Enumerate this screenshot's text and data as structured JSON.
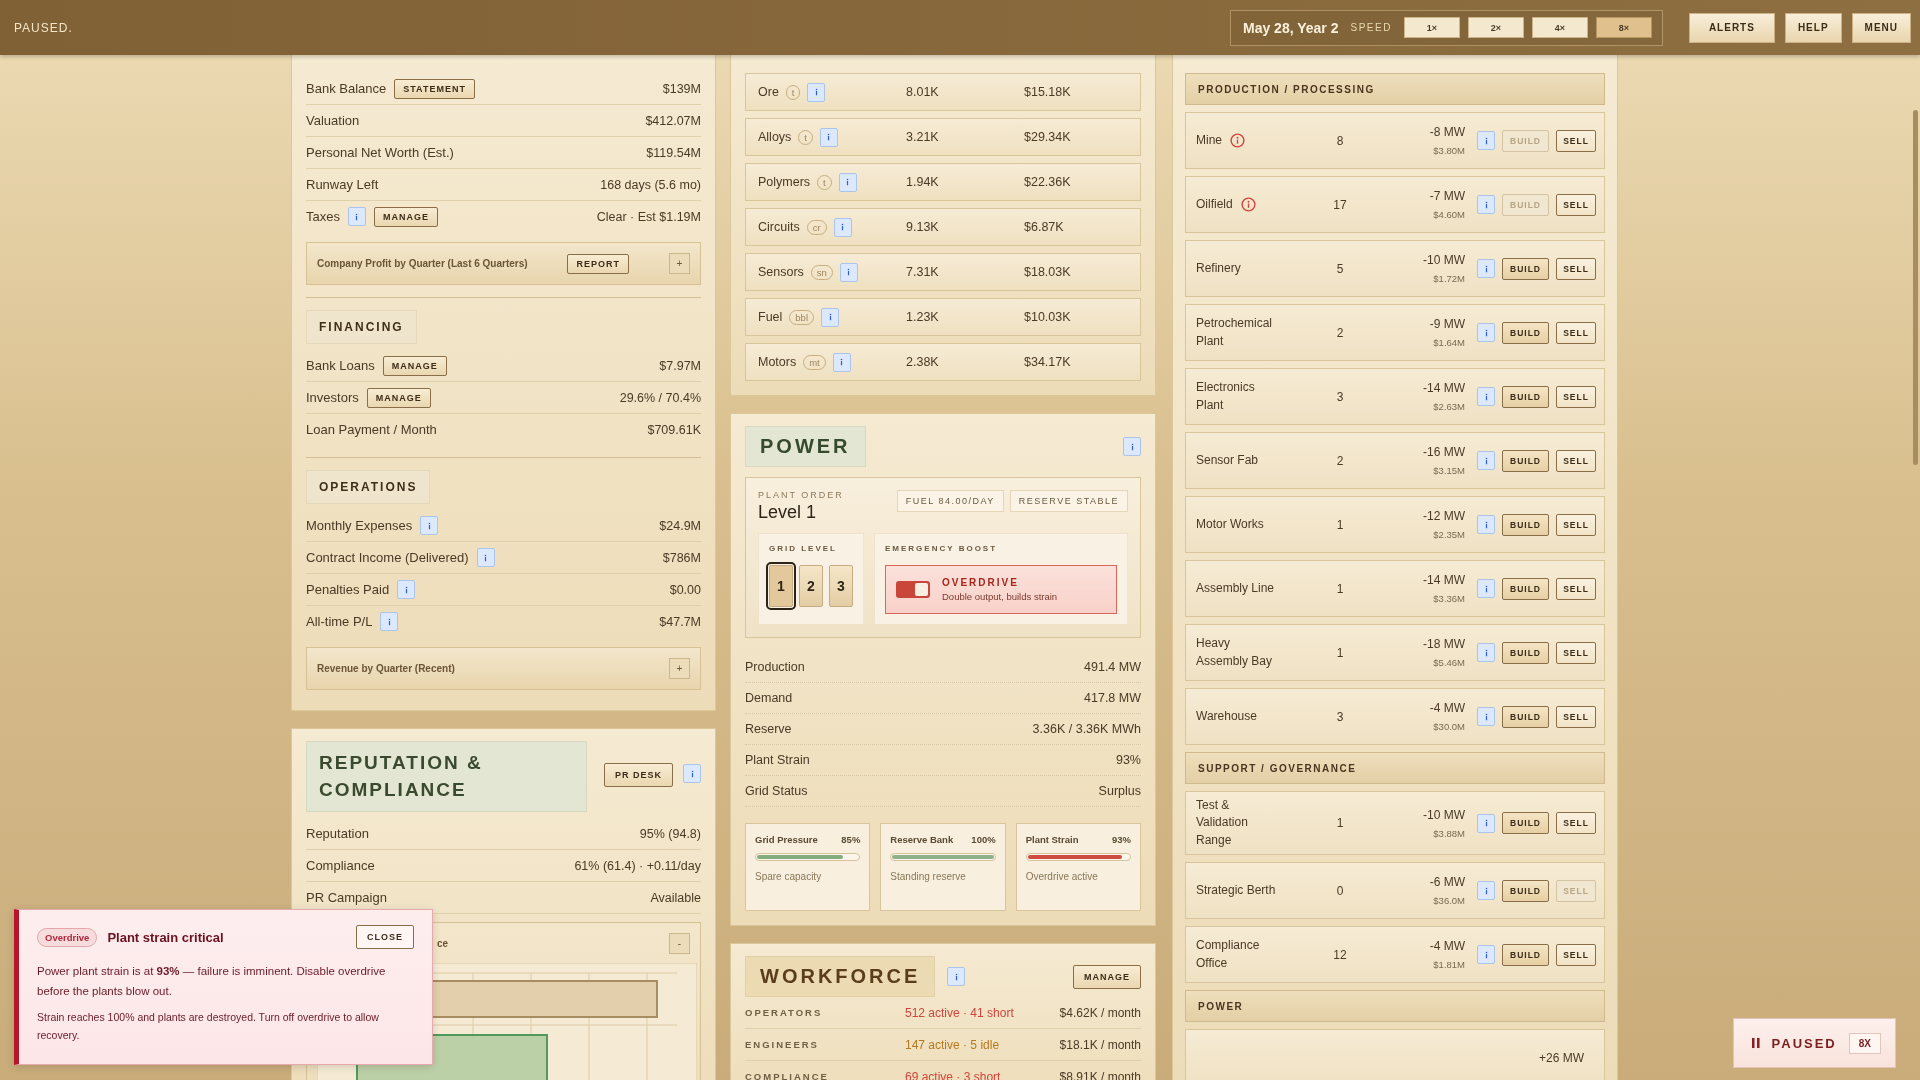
{
  "top_bar": {
    "status": "PAUSED.",
    "date": "May 28, Year 2",
    "speed_label": "SPEED",
    "speeds": [
      {
        "label": "1×",
        "selected": false
      },
      {
        "label": "2×",
        "selected": false
      },
      {
        "label": "4×",
        "selected": false
      },
      {
        "label": "8×",
        "selected": true
      }
    ],
    "buttons": [
      "ALERTS",
      "HELP",
      "MENU"
    ]
  },
  "ledger": {
    "sections": [
      {
        "rows": [
          {
            "label": "Bank Balance",
            "button": "STATEMENT",
            "value": "$139M"
          },
          {
            "label": "Valuation",
            "value": "$412.07M"
          },
          {
            "label": "Personal Net Worth (Est.)",
            "value": "$119.54M"
          },
          {
            "label": "Runway Left",
            "value": "168 days (5.6 mo)"
          },
          {
            "label": "Taxes",
            "info": true,
            "button": "MANAGE",
            "value": "Clear · Est $1.19M"
          }
        ],
        "expander": {
          "title": "Company Profit by Quarter (Last 6 Quarters)",
          "button": "REPORT",
          "toggle": "+"
        }
      },
      {
        "title": "FINANCING",
        "rows": [
          {
            "label": "Bank Loans",
            "button": "MANAGE",
            "value": "$7.97M"
          },
          {
            "label": "Investors",
            "button": "MANAGE",
            "value": "29.6% / 70.4%"
          },
          {
            "label": "Loan Payment / Month",
            "value": "$709.61K"
          }
        ]
      },
      {
        "title": "OPERATIONS",
        "rows": [
          {
            "label": "Monthly Expenses",
            "info": true,
            "value": "$24.9M"
          },
          {
            "label": "Contract Income (Delivered)",
            "info": true,
            "value": "$786M"
          },
          {
            "label": "Penalties Paid",
            "info": true,
            "value": "$0.00"
          },
          {
            "label": "All-time P/L",
            "info": true,
            "value": "$47.7M"
          }
        ],
        "expander": {
          "title": "Revenue by Quarter (Recent)",
          "toggle": "+"
        }
      }
    ]
  },
  "reputation": {
    "title": "REPUTATION & COMPLIANCE",
    "button": "PR DESK",
    "rows": [
      {
        "label": "Reputation",
        "value": "95% (94.8)"
      },
      {
        "label": "Compliance",
        "value": "61% (61.4) · +0.11/day"
      },
      {
        "label": "PR Campaign",
        "value": "Available"
      }
    ],
    "chart_box": {
      "title": "ce",
      "toggle": "-"
    }
  },
  "resources": [
    {
      "name": "Ore",
      "unit": "t",
      "amount": "8.01K",
      "value": "$15.18K"
    },
    {
      "name": "Alloys",
      "unit": "t",
      "amount": "3.21K",
      "value": "$29.34K"
    },
    {
      "name": "Polymers",
      "unit": "t",
      "amount": "1.94K",
      "value": "$22.36K"
    },
    {
      "name": "Circuits",
      "unit": "cr",
      "amount": "9.13K",
      "value": "$6.87K"
    },
    {
      "name": "Sensors",
      "unit": "sn",
      "amount": "7.31K",
      "value": "$18.03K"
    },
    {
      "name": "Fuel",
      "unit": "bbl",
      "amount": "1.23K",
      "value": "$10.03K"
    },
    {
      "name": "Motors",
      "unit": "mt",
      "amount": "2.38K",
      "value": "$34.17K"
    }
  ],
  "power": {
    "title": "POWER",
    "plant_order_label": "PLANT ORDER",
    "plant_order": "Level 1",
    "tags": [
      "FUEL 84.00/DAY",
      "RESERVE STABLE"
    ],
    "grid_level_label": "GRID LEVEL",
    "grid_levels": [
      {
        "label": "1",
        "selected": true
      },
      {
        "label": "2",
        "selected": false
      },
      {
        "label": "3",
        "selected": false
      }
    ],
    "boost_label": "EMERGENCY BOOST",
    "overdrive": {
      "title": "OVERDRIVE",
      "subtitle": "Double output, builds strain",
      "on": true
    },
    "stats": [
      {
        "label": "Production",
        "value": "491.4 MW"
      },
      {
        "label": "Demand",
        "value": "417.8 MW"
      },
      {
        "label": "Reserve",
        "value": "3.36K / 3.36K MWh"
      },
      {
        "label": "Plant Strain",
        "value": "93%"
      },
      {
        "label": "Grid Status",
        "value": "Surplus"
      }
    ],
    "meters": [
      {
        "label": "Grid Pressure",
        "reading": "85%",
        "level": 0.85,
        "color": "#86ad80",
        "note": "Spare capacity"
      },
      {
        "label": "Reserve Bank",
        "reading": "100%",
        "level": 1,
        "color": "#8fb08a",
        "note": "Standing reserve"
      },
      {
        "label": "Plant Strain",
        "reading": "93%",
        "level": 0.93,
        "color": "#cf4a40",
        "note": "Overdrive active"
      }
    ]
  },
  "workforce": {
    "title": "WORKFORCE",
    "button": "MANAGE",
    "rows": [
      {
        "role": "OPERATORS",
        "status": "512 active · 41 short",
        "kind": "short",
        "cost": "$4.62K / month"
      },
      {
        "role": "ENGINEERS",
        "status": "147 active · 5 idle",
        "kind": "idle",
        "cost": "$18.1K / month"
      },
      {
        "role": "COMPLIANCE",
        "status": "69 active · 3 short",
        "kind": "short",
        "cost": "$8.91K / month"
      }
    ]
  },
  "facilities": {
    "sections": [
      {
        "title": "PRODUCTION / PROCESSING",
        "rows": [
          {
            "name": "Mine",
            "warning": true,
            "count": "8",
            "power": "-8 MW",
            "cost": "$3.80M",
            "build": {
              "label": "BUILD",
              "disabled": true
            },
            "sell": {
              "label": "SELL",
              "disabled": false
            }
          },
          {
            "name": "Oilfield",
            "warning": true,
            "count": "17",
            "power": "-7 MW",
            "cost": "$4.60M",
            "build": {
              "label": "BUILD",
              "disabled": true
            },
            "sell": {
              "label": "SELL",
              "disabled": false
            }
          },
          {
            "name": "Refinery",
            "warning": false,
            "count": "5",
            "power": "-10 MW",
            "cost": "$1.72M",
            "build": {
              "label": "BUILD",
              "disabled": false
            },
            "sell": {
              "label": "SELL",
              "disabled": false
            }
          },
          {
            "name": "Petrochemical Plant",
            "warning": false,
            "count": "2",
            "power": "-9 MW",
            "cost": "$1.64M",
            "build": {
              "label": "BUILD",
              "disabled": false
            },
            "sell": {
              "label": "SELL",
              "disabled": false
            }
          },
          {
            "name": "Electronics Plant",
            "warning": false,
            "count": "3",
            "power": "-14 MW",
            "cost": "$2.63M",
            "build": {
              "label": "BUILD",
              "disabled": false
            },
            "sell": {
              "label": "SELL",
              "disabled": false
            }
          },
          {
            "name": "Sensor Fab",
            "warning": false,
            "count": "2",
            "power": "-16 MW",
            "cost": "$3.15M",
            "build": {
              "label": "BUILD",
              "disabled": false
            },
            "sell": {
              "label": "SELL",
              "disabled": false
            }
          },
          {
            "name": "Motor Works",
            "warning": false,
            "count": "1",
            "power": "-12 MW",
            "cost": "$2.35M",
            "build": {
              "label": "BUILD",
              "disabled": false
            },
            "sell": {
              "label": "SELL",
              "disabled": false
            }
          },
          {
            "name": "Assembly Line",
            "warning": false,
            "count": "1",
            "power": "-14 MW",
            "cost": "$3.36M",
            "build": {
              "label": "BUILD",
              "disabled": false
            },
            "sell": {
              "label": "SELL",
              "disabled": false
            }
          },
          {
            "name": "Heavy Assembly Bay",
            "warning": false,
            "count": "1",
            "power": "-18 MW",
            "cost": "$5.46M",
            "build": {
              "label": "BUILD",
              "disabled": false
            },
            "sell": {
              "label": "SELL",
              "disabled": false
            }
          },
          {
            "name": "Warehouse",
            "warning": false,
            "count": "3",
            "power": "-4 MW",
            "cost": "$30.0M",
            "build": {
              "label": "BUILD",
              "disabled": false
            },
            "sell": {
              "label": "SELL",
              "disabled": false
            }
          }
        ]
      },
      {
        "title": "SUPPORT / GOVERNANCE",
        "rows": [
          {
            "name": "Test & Validation Range",
            "warning": false,
            "count": "1",
            "power": "-10 MW",
            "cost": "$3.88M",
            "build": {
              "label": "BUILD",
              "disabled": false
            },
            "sell": {
              "label": "SELL",
              "disabled": false
            }
          },
          {
            "name": "Strategic Berth",
            "warning": false,
            "count": "0",
            "power": "-6 MW",
            "cost": "$36.0M",
            "build": {
              "label": "BUILD",
              "disabled": false
            },
            "sell": {
              "label": "SELL",
              "disabled": true
            }
          },
          {
            "name": "Compliance Office",
            "warning": false,
            "count": "12",
            "power": "-4 MW",
            "cost": "$1.81M",
            "build": {
              "label": "BUILD",
              "disabled": false
            },
            "sell": {
              "label": "SELL",
              "disabled": false
            }
          }
        ]
      },
      {
        "title": "POWER",
        "rows": [
          {
            "power": "+26 MW"
          }
        ]
      }
    ]
  },
  "toast": {
    "tag": "Overdrive",
    "title": "Plant strain critical",
    "button": "CLOSE",
    "message": "Power plant strain is at **93%** — failure is imminent. Disable overdrive before the plants blow out.",
    "note": "Strain reaches 100% and plants are destroyed. Turn off overdrive to allow recovery."
  },
  "pause_widget": {
    "label": "PAUSED",
    "speed": "8X"
  }
}
